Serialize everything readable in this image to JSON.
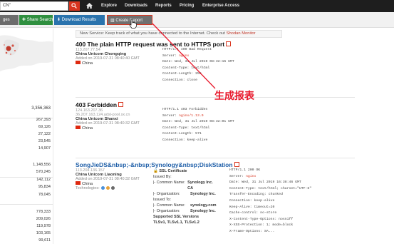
{
  "nav": {
    "search_value": "CN\"",
    "items": [
      "Explore",
      "Downloads",
      "Reports",
      "Pricing",
      "Enterprise Access"
    ]
  },
  "toolbar": {
    "left_partial": "ges",
    "share": "Share Search",
    "download": "Download Results",
    "report": "Create Report"
  },
  "notice": {
    "text": "New Service: Keep track of what you have connected to the Internet. Check out ",
    "link": "Shodan Monitor"
  },
  "sidebar": {
    "total": "3,356,363",
    "group1": [
      "267,393",
      "69,126",
      "27,122",
      "23,545",
      "14,907"
    ],
    "group2": [
      "1,148,556",
      "570,245",
      "142,112",
      "95,834",
      "78,045"
    ],
    "group3": [
      "778,333",
      "209,026",
      "119,978",
      "103,165",
      "99,611"
    ]
  },
  "results": [
    {
      "title": "400 The plain HTTP request was sent to HTTPS port",
      "ip": "113.207.77.54",
      "org": "China Unicom Chongqing",
      "added": "Added on 2019-07-31 08:40:40 GMT",
      "country": "China",
      "response": [
        "HTTP/1.1 400 Bad Request",
        "Server: nginx",
        "Date: Wed, 31 Jul 2019 08:32:15 GMT",
        "Content-Type: text/html",
        "Content-Length: 255",
        "Connection: close"
      ]
    },
    {
      "title": "403 Forbidden",
      "ip": "124.163.207.36",
      "hostname": "36.207.163.124.adsl-pool.sx.cn",
      "org": "China Unicom Shanxi",
      "added": "Added on 2019-07-31 08:40:32 GMT",
      "country": "China",
      "response": [
        "HTTP/1.1 403 Forbidden",
        "Server: nginx/1.13.9",
        "Date: Wed, 31 Jul 2019 08:32:01 GMT",
        "Content-Type: text/html",
        "Content-Length: 571",
        "Connection: keep-alive"
      ]
    },
    {
      "title": "SongJieDS&nbsp;-&nbsp;Synology&nbsp;DiskStation",
      "ip": "113.204.136.157",
      "org": "China Unicom Liaoning",
      "added": "Added on 2019-07-31 08:40:32 GMT",
      "country": "China",
      "technologies": "Technologies:",
      "ssl": {
        "header": "SSL Certificate",
        "issued_by": "Issued By:",
        "common_name_label": "|- Common Name:",
        "issuer_cn": "Synology Inc. CA",
        "org_label": "|- Organization:",
        "issuer_org": "Synology Inc.",
        "issued_to": "Issued To:",
        "subject_cn": "synology.com",
        "subject_org": "Synology Inc.",
        "versions_label": "Supported SSL Versions",
        "versions": "TLSv1, TLSv1.1, TLSv1.2"
      },
      "response": [
        "HTTP/1.1 200 OK",
        "Server: nginx",
        "Date: Wed, 31 Jul 2019 16:38:46 GMT",
        "Content-Type: text/html; charset=\"UTF-8\"",
        "Transfer-Encoding: chunked",
        "Connection: keep-alive",
        "Keep-Alive: timeout=20",
        "Cache-control: no-store",
        "X-Content-Type-Options: nosniff",
        "X-XSS-Protection: 1; mode=block",
        "X-Frame-Options: SA..."
      ]
    }
  ],
  "annotation": "生成报表",
  "colors": {
    "accent_red": "#d9351f",
    "link_blue": "#1f5fa8",
    "annotation": "#e8192c",
    "share_green": "#2f8f3f",
    "download_blue": "#2a73ad"
  }
}
